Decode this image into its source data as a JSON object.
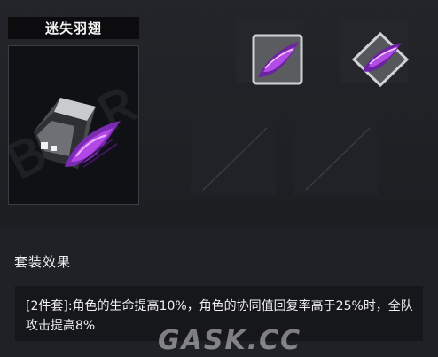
{
  "item": {
    "name": "迷失羽翅",
    "icon": "purple-feather-wing-icon"
  },
  "variants": [
    {
      "icon": "purple-wing-square-icon"
    },
    {
      "icon": "purple-wing-diamond-icon"
    },
    {
      "icon": "empty-slot-icon"
    },
    {
      "icon": "empty-slot-icon"
    }
  ],
  "set_effect": {
    "title": "套装效果",
    "description": "[2件套]:角色的生命提高10%，角色的协同值回复率高于25%时，全队攻击提高8%"
  },
  "watermark": {
    "text": "GASK.CC"
  },
  "colors": {
    "accent": "#9b2fd6",
    "panel": "#1f2126"
  }
}
